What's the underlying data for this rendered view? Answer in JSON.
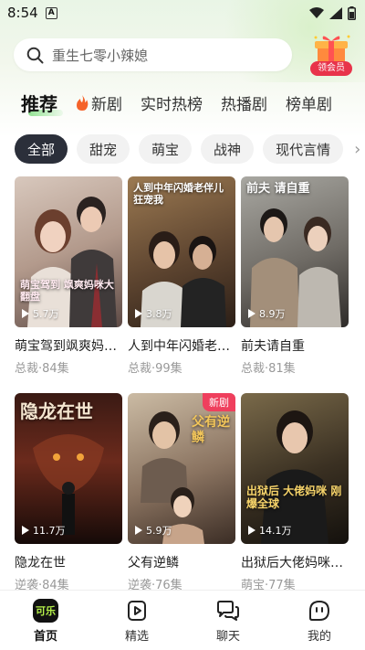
{
  "status_bar": {
    "time": "8:54",
    "notif_icon": "A"
  },
  "search": {
    "placeholder": "重生七零小辣媳",
    "vip_label": "领会员"
  },
  "main_tabs": [
    {
      "label": "推荐",
      "active": true
    },
    {
      "label": "新剧",
      "icon": "fire-icon"
    },
    {
      "label": "实时热榜"
    },
    {
      "label": "热播剧"
    },
    {
      "label": "榜单剧"
    }
  ],
  "chips": [
    "全部",
    "甜宠",
    "萌宝",
    "战神",
    "现代言情"
  ],
  "cards": [
    {
      "title": "萌宝驾到飒爽妈咪…",
      "meta": "总裁·84集",
      "plays": "5.7万",
      "poster_text": "萌宝驾到 飒爽妈咪大翻盘",
      "colors": [
        "#c9b3a8",
        "#6d5a55"
      ]
    },
    {
      "title": "人到中年闪婚老…",
      "meta": "总裁·99集",
      "plays": "3.8万",
      "poster_text": "人到中年闪婚老伴儿 狂宠我",
      "colors": [
        "#7a5a3c",
        "#3a2a20"
      ]
    },
    {
      "title": "前夫请自重",
      "meta": "总裁·81集",
      "plays": "8.9万",
      "poster_text": "前夫 请自重",
      "colors": [
        "#8a8a86",
        "#3d3b3b"
      ]
    },
    {
      "title": "隐龙在世",
      "meta": "逆袭·84集",
      "plays": "11.7万",
      "poster_text": "隐龙在世",
      "colors": [
        "#5a2a1e",
        "#1a0c0a"
      ]
    },
    {
      "title": "父有逆鳞",
      "meta": "逆袭·76集",
      "plays": "5.9万",
      "poster_text": "父有逆鳞",
      "colors": [
        "#b6a58e",
        "#4a3a30"
      ],
      "tag": "新剧"
    },
    {
      "title": "出狱后大佬妈咪…",
      "meta": "萌宝·77集",
      "plays": "14.1万",
      "poster_text": "出狱后 大佬妈咪 刚爆全球",
      "colors": [
        "#6a5a3c",
        "#1e1a14"
      ]
    }
  ],
  "bottom_nav": [
    {
      "label": "首页",
      "icon": "home-logo-icon",
      "active": true,
      "logo_text": "可乐"
    },
    {
      "label": "精选",
      "icon": "video-play-icon"
    },
    {
      "label": "聊天",
      "icon": "chat-bubbles-icon"
    },
    {
      "label": "我的",
      "icon": "profile-face-icon"
    }
  ]
}
